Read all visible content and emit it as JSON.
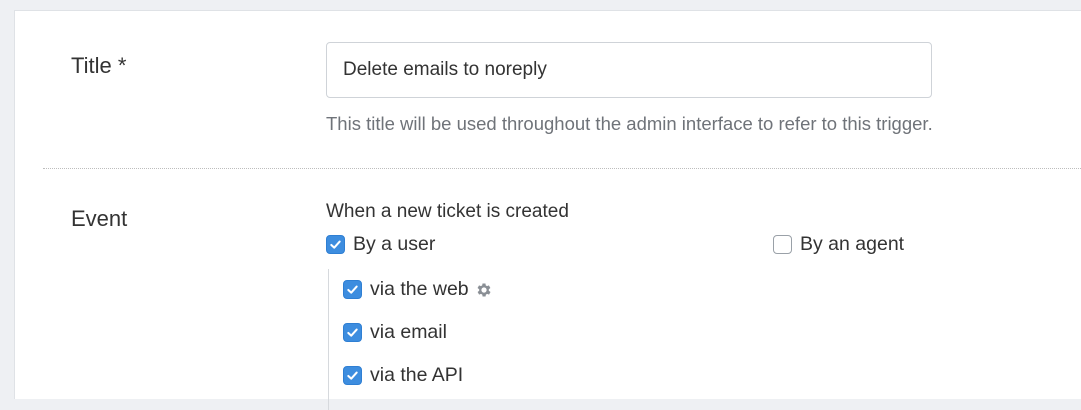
{
  "form": {
    "title_label": "Title *",
    "title_value": "Delete emails to noreply",
    "title_help": "This title will be used throughout the admin interface to refer to this trigger.",
    "event_label": "Event",
    "event_heading": "When a new ticket is created",
    "options": {
      "by_user": {
        "label": "By a user",
        "checked": true
      },
      "by_agent": {
        "label": "By an agent",
        "checked": false
      },
      "via_web": {
        "label": "via the web",
        "checked": true,
        "icon": "gear-icon"
      },
      "via_email": {
        "label": "via email",
        "checked": true
      },
      "via_api": {
        "label": "via the API",
        "checked": true
      }
    }
  },
  "colors": {
    "checkbox_checked": "#3d8ddf",
    "help_text": "#6f7379"
  }
}
